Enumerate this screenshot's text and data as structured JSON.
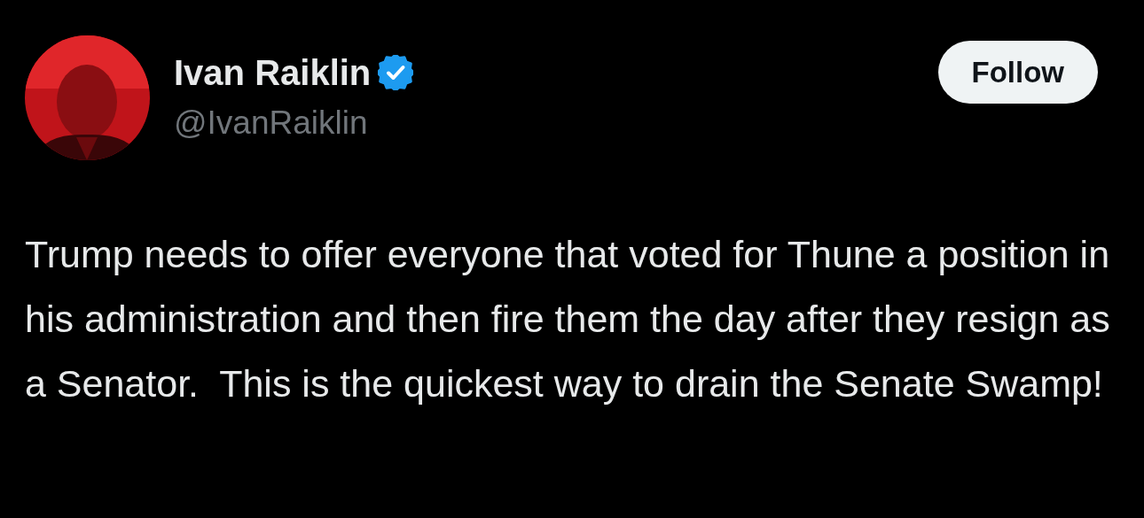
{
  "author": {
    "name": "Ivan Raiklin",
    "handle": "@IvanRaiklin",
    "verified": true
  },
  "follow_button": {
    "label": "Follow"
  },
  "post": {
    "text": "Trump needs to offer everyone that voted for Thune a position in his administration and then fire them the day after they resign as a Senator.  This is the quickest way to drain the Senate Swamp!"
  }
}
